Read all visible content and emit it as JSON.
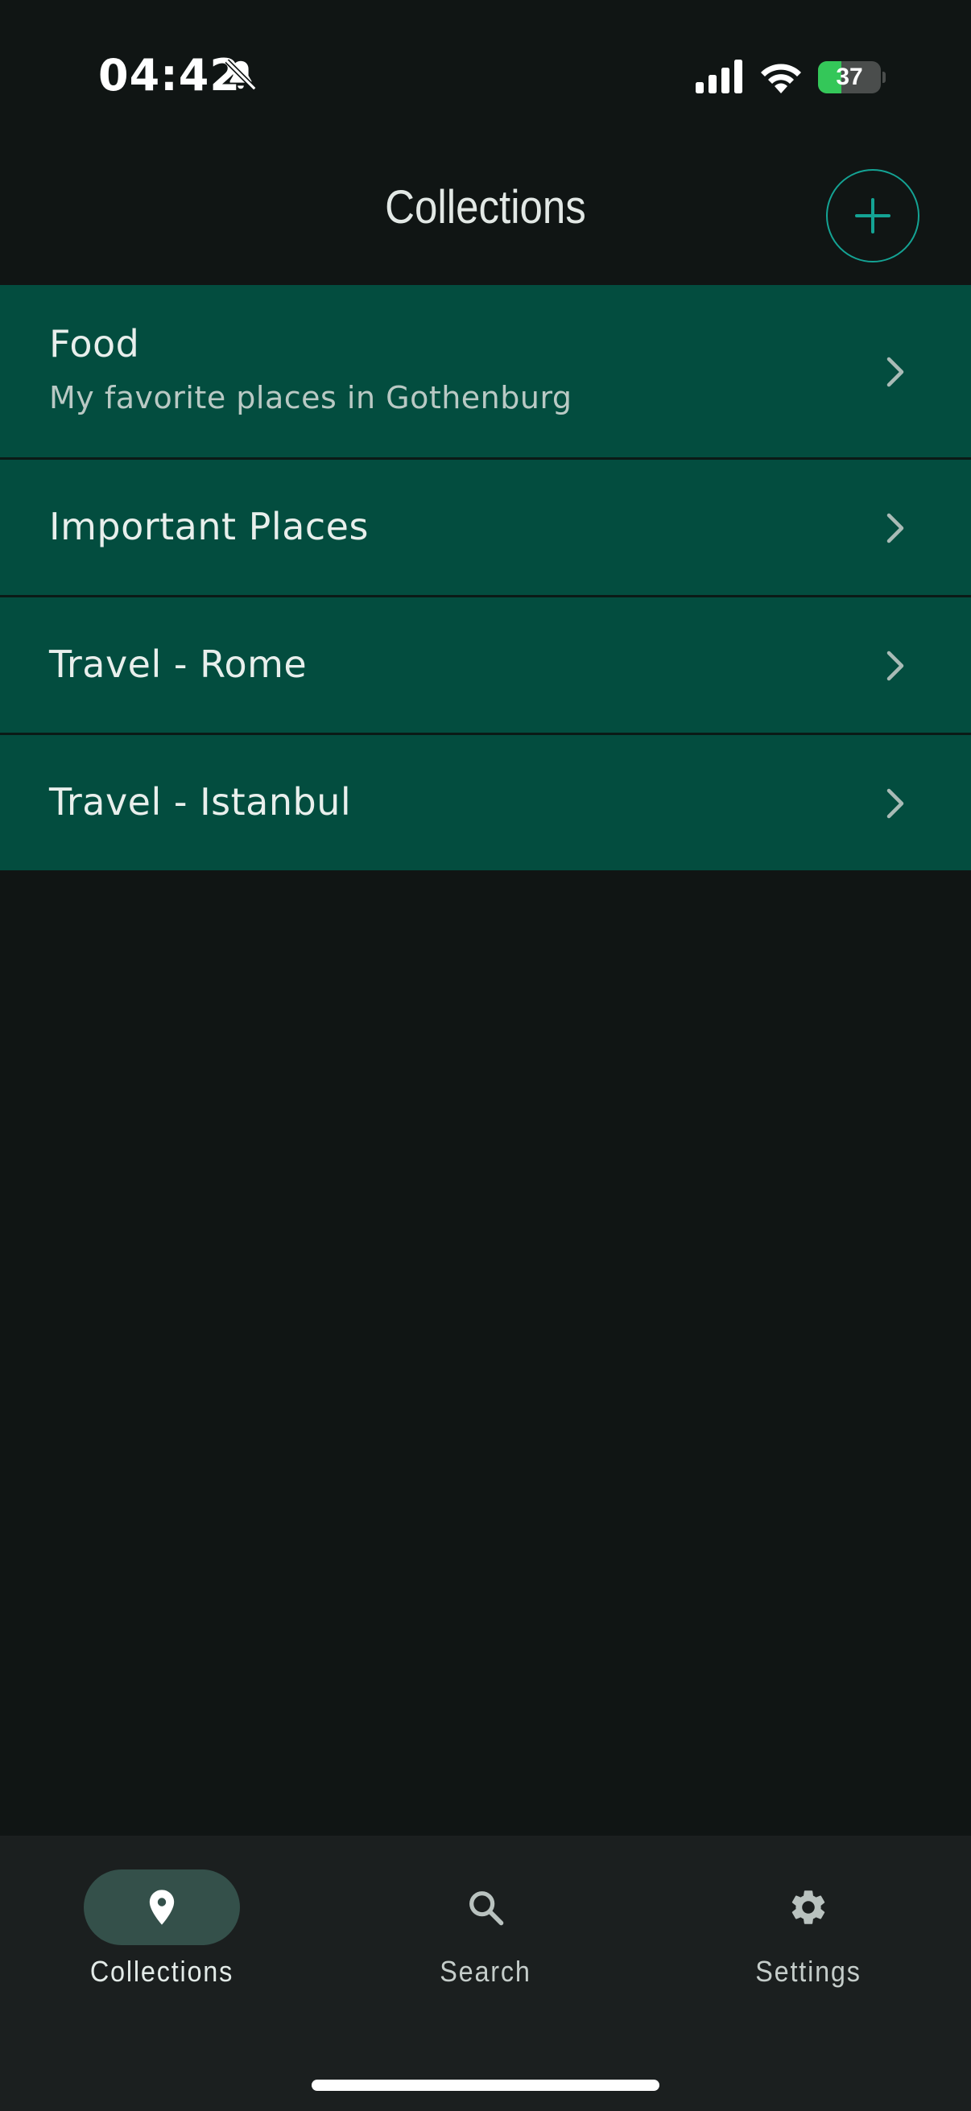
{
  "status_bar": {
    "time": "04:42",
    "battery": "37",
    "battery_level": 0.37
  },
  "header": {
    "title": "Collections",
    "add_button_icon": "plus-icon"
  },
  "collections": [
    {
      "title": "Food",
      "subtitle": "My favorite places in Gothenburg"
    },
    {
      "title": "Important Places",
      "subtitle": ""
    },
    {
      "title": "Travel - Rome",
      "subtitle": ""
    },
    {
      "title": "Travel - Istanbul",
      "subtitle": ""
    }
  ],
  "bottom_nav": {
    "items": [
      {
        "label": "Collections",
        "icon": "map-pin-icon",
        "active": true
      },
      {
        "label": "Search",
        "icon": "search-icon",
        "active": false
      },
      {
        "label": "Settings",
        "icon": "gear-icon",
        "active": false
      }
    ]
  },
  "colors": {
    "background": "#101514",
    "list_item": "#034d3f",
    "accent": "#14a394",
    "nav_background": "#1b1f1f",
    "nav_active_pill": "#34504a"
  }
}
